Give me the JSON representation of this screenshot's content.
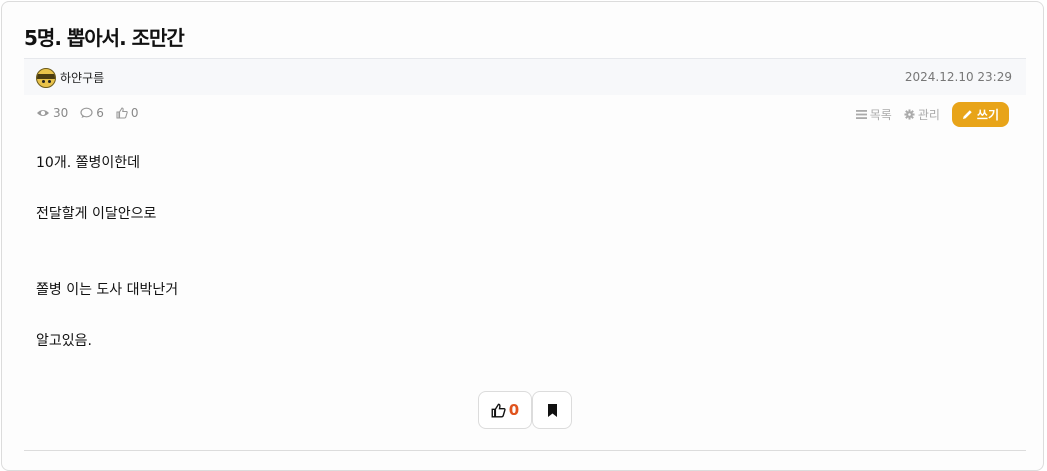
{
  "post": {
    "title": "5명. 뽑아서. 조만간",
    "author": "하얀구름",
    "datetime": "2024.12.10 23:29",
    "stats": {
      "views": "30",
      "comments": "6",
      "likes": "0"
    },
    "actions": {
      "list_label": "목록",
      "manage_label": "관리",
      "write_label": "쓰기"
    },
    "body_lines": [
      "10개. 쫄병이한데",
      "전달할게 이달안으로",
      "쫄병 이는 도사 대박난거",
      "알고있음."
    ],
    "reaction": {
      "like_count": "0"
    }
  },
  "colors": {
    "accent": "#e8a419",
    "like_count": "#e0531d"
  },
  "icons": [
    "eye-icon",
    "comment-icon",
    "thumbs-up-icon",
    "list-icon",
    "gear-icon",
    "pencil-icon",
    "bookmark-icon"
  ]
}
